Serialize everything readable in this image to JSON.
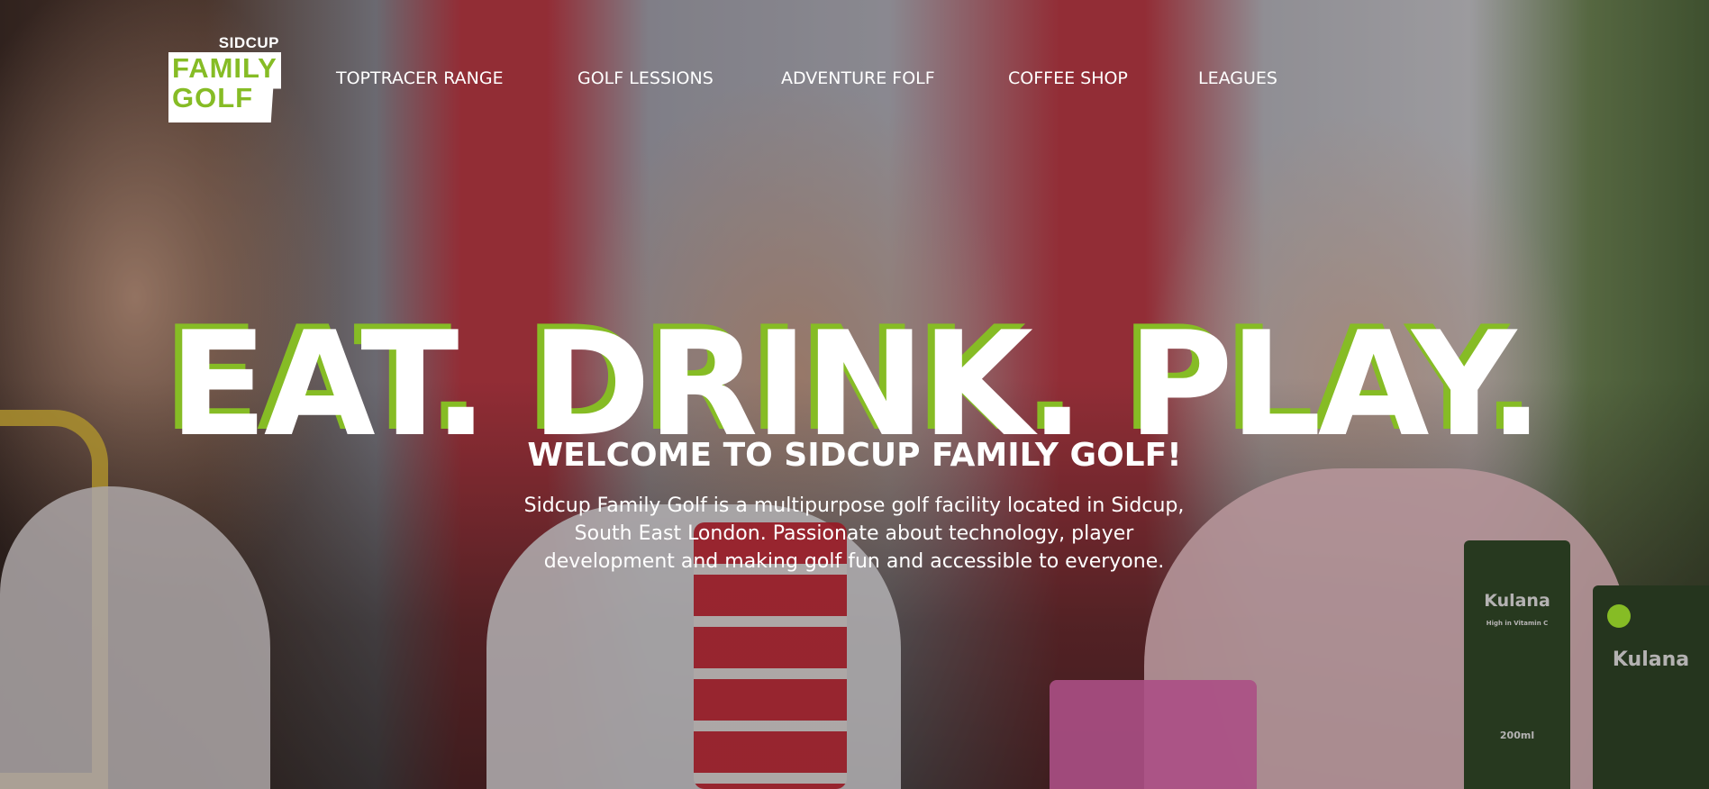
{
  "brand": {
    "logo_top": "SIDCUP",
    "logo_line1": "FAMILY",
    "logo_line2": "GOLF",
    "accent_color": "#86bc25"
  },
  "nav": {
    "items": [
      {
        "label": "TOPTRACER RANGE"
      },
      {
        "label": "GOLF LESSIONS"
      },
      {
        "label": "ADVENTURE FOLF"
      },
      {
        "label": "COFFEE SHOP"
      },
      {
        "label": "LEAGUES"
      }
    ]
  },
  "hero": {
    "headline": "EAT. DRINK. PLAY.",
    "welcome": "WELCOME TO SIDCUP FAMILY GOLF!",
    "intro": "Sidcup Family Golf is a multipurpose golf facility located in Sidcup, South East London. Passionate about technology, player development and making golf fun and accessible to everyone."
  },
  "photo": {
    "juice_brand": "Kulana",
    "juice_tag": "High in Vitamin C",
    "juice_volume": "200ml"
  }
}
